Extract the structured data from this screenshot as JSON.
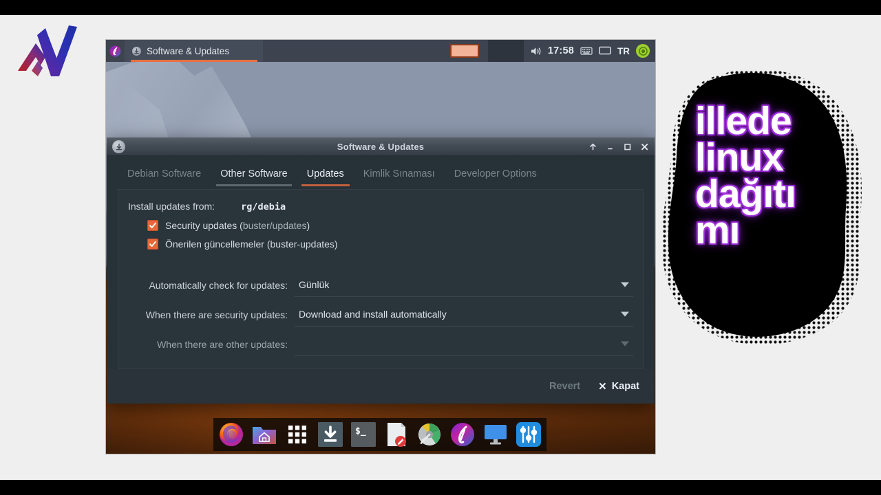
{
  "brand": {
    "logo_name": "AV monogram logo"
  },
  "panel": {
    "launcher_icon": "menu-launcher-icon",
    "window_button": {
      "icon": "software-updates-icon",
      "title": "Software & Updates"
    },
    "tray": {
      "thumbnail": "workspace-thumbnail",
      "volume_icon": "volume-icon",
      "clock": "17:58",
      "keyboard_icon": "keyboard-icon",
      "display_icon": "display-icon",
      "language": "TR",
      "power_icon": "power-icon"
    }
  },
  "dialog": {
    "icon": "software-updates-icon",
    "title": "Software & Updates",
    "controls": {
      "shade": "shade-window-button",
      "minimize": "minimize-button",
      "maximize": "maximize-button",
      "close": "close-button"
    },
    "tabs": [
      {
        "label": "Debian Software",
        "state": "inactive"
      },
      {
        "label": "Other Software",
        "state": "hover"
      },
      {
        "label": "Updates",
        "state": "active"
      },
      {
        "label": "Kimlik Sınaması",
        "state": "inactive"
      },
      {
        "label": "Developer Options",
        "state": "inactive"
      }
    ],
    "install_from": {
      "label": "Install updates from:",
      "value": "rg/debia"
    },
    "checkboxes": [
      {
        "label": "Security updates (",
        "ghost": "buster/updates",
        "tail": ")",
        "checked": true
      },
      {
        "label": "Önerilen güncellemeler (buster-updates)",
        "ghost": "",
        "tail": "",
        "checked": true
      }
    ],
    "selects": [
      {
        "label": "Automatically check for updates:",
        "value": "Günlük",
        "disabled": false
      },
      {
        "label": "When there are security updates:",
        "value": "Download and install automatically",
        "disabled": false
      },
      {
        "label": "When there are other updates:",
        "value": "",
        "disabled": true
      }
    ],
    "footer": {
      "revert_label": "Revert",
      "close_x": "✕",
      "close_label": "Kapat"
    }
  },
  "dock": {
    "items": [
      {
        "name": "firefox-icon"
      },
      {
        "name": "file-manager-icon"
      },
      {
        "name": "app-grid-icon"
      },
      {
        "name": "software-installer-icon"
      },
      {
        "name": "terminal-icon"
      },
      {
        "name": "text-editor-icon"
      },
      {
        "name": "disk-usage-icon"
      },
      {
        "name": "distro-logo-icon"
      },
      {
        "name": "display-settings-icon"
      },
      {
        "name": "settings-mixer-icon"
      }
    ]
  },
  "caption": {
    "lines": [
      "illede",
      "linux",
      "dağıtı",
      "mı"
    ]
  },
  "colors": {
    "accent_orange": "#e8663c",
    "tab_active": "#c1603c",
    "panel_bg": "#3d4450",
    "dialog_bg": "#273138",
    "caption_glow": "#a832e0"
  }
}
